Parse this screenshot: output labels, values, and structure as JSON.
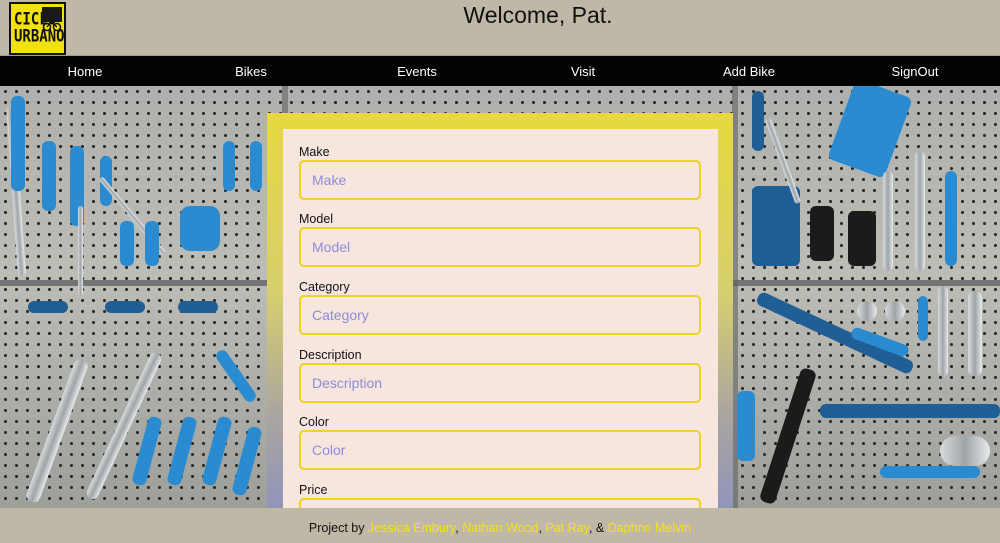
{
  "header": {
    "logo_line1": "CICLO",
    "logo_line2": "URBANO",
    "welcome": "Welcome, Pat."
  },
  "nav": {
    "items": [
      {
        "label": "Home"
      },
      {
        "label": "Bikes"
      },
      {
        "label": "Events"
      },
      {
        "label": "Visit"
      },
      {
        "label": "Add Bike"
      },
      {
        "label": "SignOut"
      }
    ]
  },
  "form": {
    "fields": [
      {
        "label": "Make",
        "placeholder": "Make"
      },
      {
        "label": "Model",
        "placeholder": "Model"
      },
      {
        "label": "Category",
        "placeholder": "Category"
      },
      {
        "label": "Description",
        "placeholder": "Description"
      },
      {
        "label": "Color",
        "placeholder": "Color"
      },
      {
        "label": "Price",
        "placeholder": ""
      }
    ]
  },
  "footer": {
    "prefix": "Project by ",
    "authors": [
      "Jessica Embury",
      "Nathan Wood",
      "Pat Ray",
      "Daphne Melvin"
    ],
    "sep1": ", ",
    "sep2": ", ",
    "sep3": ", & "
  },
  "colors": {
    "accent_yellow": "#efd223",
    "nav_bg": "#030303",
    "header_bg": "#bfb8a6",
    "panel_bg": "#f6e6de",
    "placeholder": "#8e8bd7"
  }
}
